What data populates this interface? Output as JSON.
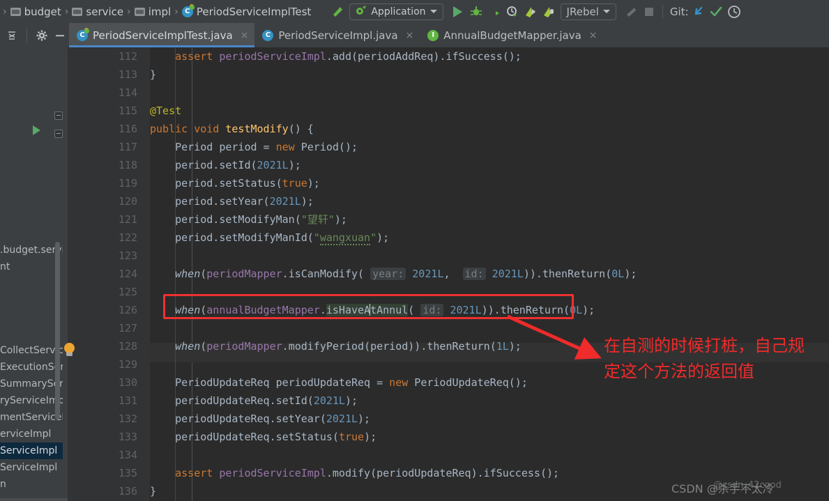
{
  "toolbar": {
    "breadcrumbs": [
      {
        "label": "budget",
        "icon": "folder-icon"
      },
      {
        "label": "service",
        "icon": "folder-icon"
      },
      {
        "label": "impl",
        "icon": "folder-icon"
      },
      {
        "label": "PeriodServiceImplTest",
        "icon": "test-class-icon"
      }
    ],
    "run_config": {
      "label": "Application",
      "icon": "run-config-icon",
      "dropdown": "▾"
    },
    "buttons": [
      {
        "name": "run-button",
        "label": "▶"
      },
      {
        "name": "debug-button",
        "label": "debug"
      },
      {
        "name": "run-coverage-button",
        "label": "coverage"
      },
      {
        "name": "profiler-button",
        "label": "profiler"
      },
      {
        "name": "jrebel-run-button",
        "label": "jrebel-run"
      },
      {
        "name": "jrebel-debug-button",
        "label": "jrebel-debug"
      }
    ],
    "jrebel": {
      "label": "JRebel",
      "dropdown": "▾"
    },
    "stop_label": "■",
    "git": {
      "label": "Git:",
      "update_icon": "update-project-icon",
      "commit_icon": "commit-icon",
      "history_icon": "history-icon"
    }
  },
  "tabbar": {
    "left_tools": [
      {
        "name": "collapse-all-icon",
        "label": "≡"
      },
      {
        "name": "settings-gear-icon",
        "label": "⚙"
      },
      {
        "name": "hide-panel-icon",
        "label": "—"
      }
    ],
    "tabs": [
      {
        "label": "PeriodServiceImplTest.java",
        "icon": "test-class-icon",
        "active": true,
        "close": "×"
      },
      {
        "label": "PeriodServiceImpl.java",
        "icon": "class-icon",
        "active": false,
        "close": "×"
      },
      {
        "label": "AnnualBudgetMapper.java",
        "icon": "interface-icon",
        "active": false,
        "close": "×"
      }
    ]
  },
  "editor": {
    "first_line": 112,
    "lines": [
      {
        "n": 112,
        "text": "        assert periodServiceImpl.add(periodAddReq).ifSuccess();"
      },
      {
        "n": 113,
        "text": "    }"
      },
      {
        "n": 114,
        "text": ""
      },
      {
        "n": 115,
        "text": "    @Test"
      },
      {
        "n": 116,
        "text": "    public void testModify() {"
      },
      {
        "n": 117,
        "text": "        Period period = new Period();"
      },
      {
        "n": 118,
        "text": "        period.setId(2021L);"
      },
      {
        "n": 119,
        "text": "        period.setStatus(true);"
      },
      {
        "n": 120,
        "text": "        period.setYear(2021L);"
      },
      {
        "n": 121,
        "text": "        period.setModifyMan(\"望轩\");"
      },
      {
        "n": 122,
        "text": "        period.setModifyManId(\"wangxuan\");"
      },
      {
        "n": 123,
        "text": ""
      },
      {
        "n": 124,
        "text": "        when(periodMapper.isCanModify( year: 2021L,  id: 2021L)).thenReturn(0L);"
      },
      {
        "n": 125,
        "text": ""
      },
      {
        "n": 126,
        "text": "        when(annualBudgetMapper.isHaveAtAnnul( id: 2021L)).thenReturn(0L);"
      },
      {
        "n": 127,
        "text": ""
      },
      {
        "n": 128,
        "text": "        when(periodMapper.modifyPeriod(period)).thenReturn(1L);"
      },
      {
        "n": 129,
        "text": ""
      },
      {
        "n": 130,
        "text": "        PeriodUpdateReq periodUpdateReq = new PeriodUpdateReq();"
      },
      {
        "n": 131,
        "text": "        periodUpdateReq.setId(2021L);"
      },
      {
        "n": 132,
        "text": "        periodUpdateReq.setYear(2021L);"
      },
      {
        "n": 133,
        "text": "        periodUpdateReq.setStatus(true);"
      },
      {
        "n": 134,
        "text": ""
      },
      {
        "n": 135,
        "text": "        assert periodServiceImpl.modify(periodUpdateReq).ifSuccess();"
      },
      {
        "n": 136,
        "text": "    }"
      }
    ],
    "gutter": {
      "run_marker_line": 116,
      "bulb_line": 126,
      "fold_lines": [
        113,
        116,
        136
      ]
    },
    "highlighted_line": 126,
    "parameter_hints": [
      "year:",
      "id:"
    ]
  },
  "annotation": {
    "text_line1": "在自测的时候打桩，自己规",
    "text_line2": "定这个方法的返回值",
    "box_color": "#f03030",
    "arrow_color": "#ef2b2b"
  },
  "left_popup": {
    "items": [
      {
        "label": ".budget.servi",
        "selected": false
      },
      {
        "label": "nt",
        "selected": false
      },
      {
        "label": "",
        "selected": false
      },
      {
        "label": "",
        "selected": false
      },
      {
        "label": "",
        "selected": false
      },
      {
        "label": "",
        "selected": false
      },
      {
        "label": "CollectServic",
        "selected": false
      },
      {
        "label": "ExecutionSer",
        "selected": false
      },
      {
        "label": "SummarySer",
        "selected": false
      },
      {
        "label": "ryServiceImp",
        "selected": false
      },
      {
        "label": "mentServiceI",
        "selected": false
      },
      {
        "label": "erviceImpl",
        "selected": false
      },
      {
        "label": "ServiceImpl",
        "selected": true
      },
      {
        "label": "ServiceImpl",
        "selected": false
      },
      {
        "label": "n",
        "selected": false
      }
    ]
  },
  "watermark": {
    "text": "CSDN @杀手不太冷",
    "overlay": "@csdn_42cood"
  },
  "colors": {
    "editor_bg": "#2b2b2b",
    "gutter_bg": "#313335",
    "chrome_bg": "#3c3f41",
    "accent_blue": "#4a88c7",
    "keyword": "#cc7832",
    "number": "#6897bb",
    "string": "#6a8759",
    "method": "#ffc66d",
    "field": "#9876aa",
    "annotation": "#bbb529",
    "default_text": "#a9b7c6"
  }
}
